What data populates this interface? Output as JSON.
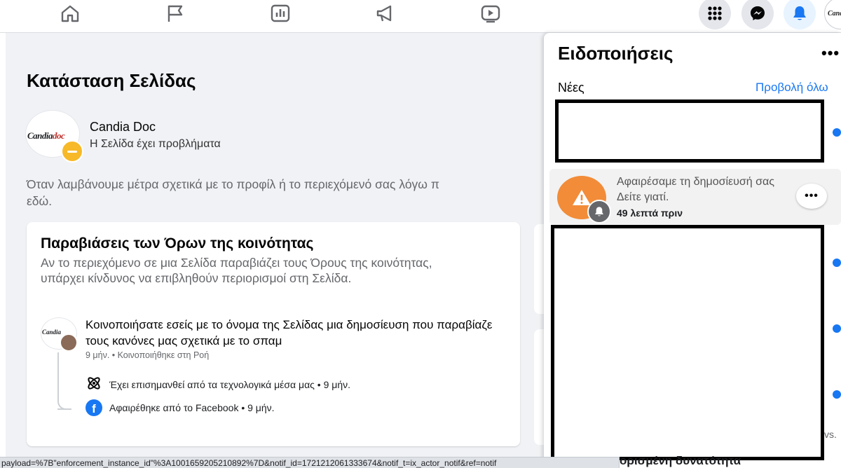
{
  "topbar": {
    "nav_icons": [
      "home-icon",
      "flag-icon",
      "chart-icon",
      "megaphone-icon",
      "video-icon"
    ],
    "menu_icon": "grid-icon",
    "messenger_icon": "messenger-icon",
    "notifications_icon": "bell-icon",
    "profile_avatar_text": "Candia",
    "active_color": "#1877f2"
  },
  "page_status": {
    "title": "Κατάσταση Σελίδας",
    "page_name": "Candia Doc",
    "status_text": "Η Σελίδα έχει προβλήματα",
    "logo_text_1": "Candia",
    "logo_text_2": "doc",
    "status_badge_color": "#f7b928",
    "intro_line_1": "Όταν λαμβάνουμε μέτρα σχετικά με το προφίλ ή το περιεχόμενό σας λόγω π",
    "intro_line_2": "εδώ."
  },
  "violations_card": {
    "title": "Παραβιάσεις των Όρων της κοινότητας",
    "description": "Αν το περιεχόμενο σε μια Σελίδα παραβιάζει τους Όρους της κοινότητας, υπάρχει κίνδυνος να επιβληθούν περιορισμοί στη Σελίδα.",
    "post": {
      "avatar_text": "Candia",
      "text": "Κοινοποιήσατε εσείς με το όνομα της Σελίδας μια δημοσίευση που παραβίαζε τους κανόνες μας σχετικά με το σπαμ",
      "meta": "9 μήν. • Κοινοποιήθηκε στη Ροή"
    },
    "events": [
      {
        "icon": "atom-icon",
        "text": "Έχει επισημανθεί από τα τεχνολογικά μέσα μας • 9 μήν."
      },
      {
        "icon": "facebook-icon",
        "text": "Αφαιρέθηκε από το Facebook • 9 μήν."
      }
    ]
  },
  "notifications": {
    "title": "Ειδοποιήσεις",
    "more_label": "•••",
    "section_label": "Νέες",
    "see_all_label": "Προβολή όλω",
    "item": {
      "line1": "Αφαιρέσαμε τη δημοσίευσή σας",
      "line2": "Δείτε γιατί.",
      "time": "49 λεπτά πριν",
      "icon": "warning-icon",
      "badge_icon": "bell-icon",
      "more_label": "•••",
      "icon_color": "#f28c38"
    },
    "partial_right_text": "vs.",
    "bottom_partial_text": "ορισμένη δυνατότητα"
  },
  "statusbar": {
    "url": "payload=%7B\"enforcement_instance_id\"%3A1001659205210892%7D&notif_id=1721212061333674&notif_t=ix_actor_notif&ref=notif"
  }
}
